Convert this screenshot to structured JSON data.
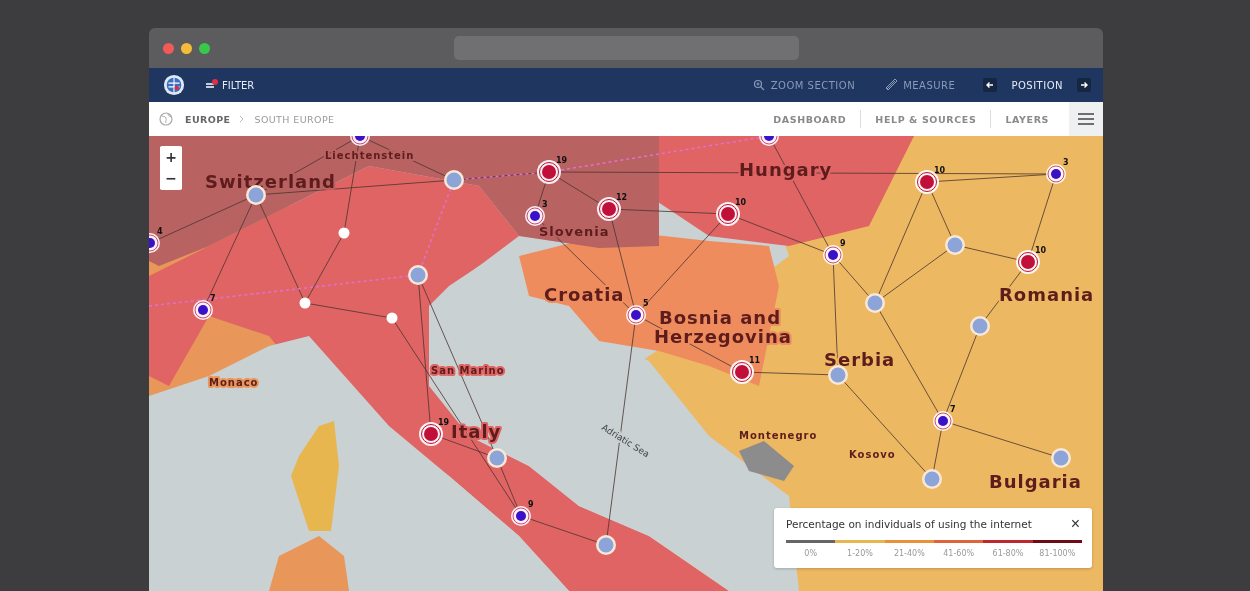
{
  "nav": {
    "filter": "FILTER",
    "tools": [
      {
        "kind": "zoom",
        "label": "ZOOM SECTION"
      },
      {
        "kind": "measure",
        "label": "MEASURE"
      }
    ],
    "position": "POSITION"
  },
  "breadcrumb": [
    "EUROPE",
    "SOUTH EUROPE"
  ],
  "menu": [
    "DASHBOARD",
    "HELP & SOURCES",
    "LAYERS"
  ],
  "zoom_controls": [
    "+",
    "−"
  ],
  "map": {
    "labels": [
      {
        "kind": "small",
        "text": "Liechtenstein"
      },
      {
        "kind": "large",
        "text": "Switzerland"
      },
      {
        "kind": "medium",
        "text": "Slovenia"
      },
      {
        "kind": "large",
        "text": "Hungary"
      },
      {
        "kind": "large",
        "text": "Croatia"
      },
      {
        "kind": "large",
        "text": "Bosnia and"
      },
      {
        "kind": "large",
        "text": "Herzegovina"
      },
      {
        "kind": "large",
        "text": "Romania"
      },
      {
        "kind": "large",
        "text": "Serbia"
      },
      {
        "kind": "small",
        "text": "San Marino"
      },
      {
        "kind": "large",
        "text": "Italy"
      },
      {
        "kind": "small",
        "text": "Monaco"
      },
      {
        "kind": "small",
        "text": "Montenegro"
      },
      {
        "kind": "small",
        "text": "Kosovo"
      },
      {
        "kind": "large",
        "text": "Bulgaria"
      },
      {
        "kind": "sea",
        "text": "Adriatic Sea"
      }
    ],
    "markers": [
      {
        "kind": "blue"
      },
      {
        "kind": "cluster"
      },
      {
        "kind": "cluster"
      },
      {
        "kind": "red",
        "count": "19"
      },
      {
        "kind": "blue",
        "count": "3"
      },
      {
        "kind": "red",
        "count": "12"
      },
      {
        "kind": "red",
        "count": "10"
      },
      {
        "kind": "blue"
      },
      {
        "kind": "red",
        "count": "10"
      },
      {
        "kind": "blue",
        "count": "3"
      },
      {
        "kind": "blue",
        "count": "4"
      },
      {
        "kind": "point"
      },
      {
        "kind": "cluster"
      },
      {
        "kind": "blue",
        "count": "7"
      },
      {
        "kind": "point"
      },
      {
        "kind": "point"
      },
      {
        "kind": "blue",
        "count": "9"
      },
      {
        "kind": "cluster"
      },
      {
        "kind": "red",
        "count": "10"
      },
      {
        "kind": "cluster"
      },
      {
        "kind": "blue",
        "count": "5"
      },
      {
        "kind": "cluster"
      },
      {
        "kind": "red",
        "count": "11"
      },
      {
        "kind": "cluster"
      },
      {
        "kind": "blue",
        "count": "7"
      },
      {
        "kind": "red",
        "count": "19"
      },
      {
        "kind": "cluster"
      },
      {
        "kind": "cluster"
      },
      {
        "kind": "cluster"
      },
      {
        "kind": "blue",
        "count": "9"
      },
      {
        "kind": "cluster"
      }
    ]
  },
  "legend": {
    "title": "Percentage on individuals of using the internet",
    "close": "×",
    "ranges": [
      {
        "label": "0%",
        "color": "#666666"
      },
      {
        "label": "1-20%",
        "color": "#e8b64f"
      },
      {
        "label": "21-40%",
        "color": "#e8923a"
      },
      {
        "label": "41-60%",
        "color": "#e0643a"
      },
      {
        "label": "61-80%",
        "color": "#c0262e"
      },
      {
        "label": "81-100%",
        "color": "#6e0b14"
      }
    ]
  }
}
